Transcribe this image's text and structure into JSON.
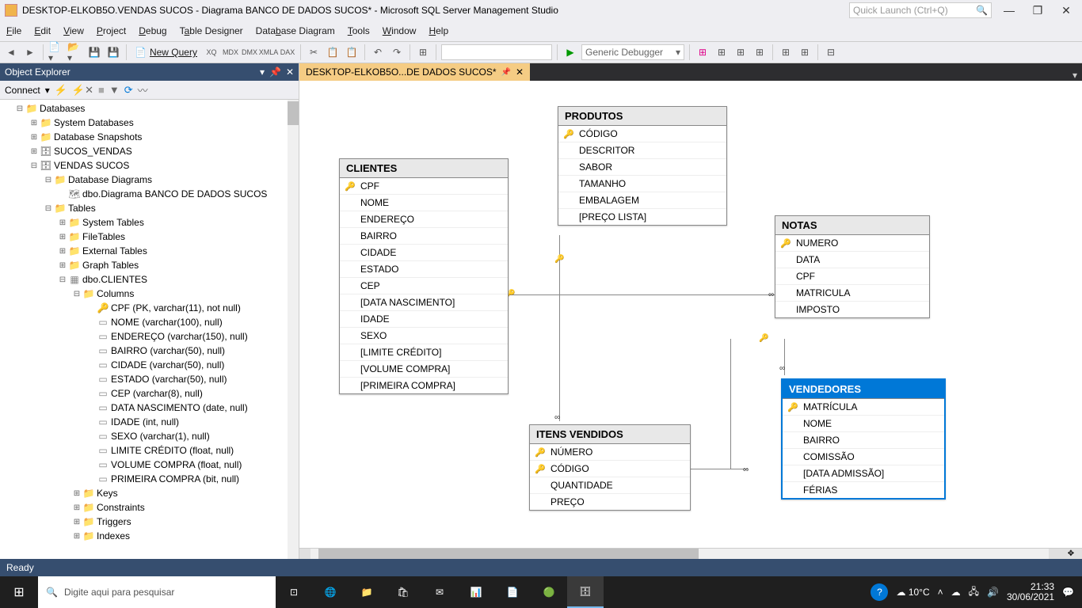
{
  "window": {
    "title": "DESKTOP-ELKOB5O.VENDAS SUCOS - Diagrama BANCO DE DADOS SUCOS* - Microsoft SQL Server Management Studio",
    "quick_launch": "Quick Launch (Ctrl+Q)"
  },
  "menubar": [
    "File",
    "Edit",
    "View",
    "Project",
    "Debug",
    "Table Designer",
    "Database Diagram",
    "Tools",
    "Window",
    "Help"
  ],
  "toolbar": {
    "new_query": "New Query",
    "debugger": "Generic Debugger"
  },
  "objexp": {
    "title": "Object Explorer",
    "connect": "Connect",
    "tree": [
      {
        "d": 1,
        "tw": "-",
        "ic": "folder",
        "tx": "Databases"
      },
      {
        "d": 2,
        "tw": "+",
        "ic": "folder",
        "tx": "System Databases"
      },
      {
        "d": 2,
        "tw": "+",
        "ic": "folder",
        "tx": "Database Snapshots"
      },
      {
        "d": 2,
        "tw": "+",
        "ic": "db",
        "tx": "SUCOS_VENDAS"
      },
      {
        "d": 2,
        "tw": "-",
        "ic": "db",
        "tx": "VENDAS SUCOS"
      },
      {
        "d": 3,
        "tw": "-",
        "ic": "folder",
        "tx": "Database Diagrams"
      },
      {
        "d": 4,
        "tw": "",
        "ic": "diag",
        "tx": "dbo.Diagrama BANCO DE DADOS SUCOS"
      },
      {
        "d": 3,
        "tw": "-",
        "ic": "folder",
        "tx": "Tables"
      },
      {
        "d": 4,
        "tw": "+",
        "ic": "folder",
        "tx": "System Tables"
      },
      {
        "d": 4,
        "tw": "+",
        "ic": "folder",
        "tx": "FileTables"
      },
      {
        "d": 4,
        "tw": "+",
        "ic": "folder",
        "tx": "External Tables"
      },
      {
        "d": 4,
        "tw": "+",
        "ic": "folder",
        "tx": "Graph Tables"
      },
      {
        "d": 4,
        "tw": "-",
        "ic": "table",
        "tx": "dbo.CLIENTES"
      },
      {
        "d": 5,
        "tw": "-",
        "ic": "folder",
        "tx": "Columns"
      },
      {
        "d": 6,
        "tw": "",
        "ic": "key",
        "tx": "CPF (PK, varchar(11), not null)"
      },
      {
        "d": 6,
        "tw": "",
        "ic": "col",
        "tx": "NOME (varchar(100), null)"
      },
      {
        "d": 6,
        "tw": "",
        "ic": "col",
        "tx": "ENDEREÇO (varchar(150), null)"
      },
      {
        "d": 6,
        "tw": "",
        "ic": "col",
        "tx": "BAIRRO (varchar(50), null)"
      },
      {
        "d": 6,
        "tw": "",
        "ic": "col",
        "tx": "CIDADE (varchar(50), null)"
      },
      {
        "d": 6,
        "tw": "",
        "ic": "col",
        "tx": "ESTADO (varchar(50), null)"
      },
      {
        "d": 6,
        "tw": "",
        "ic": "col",
        "tx": "CEP (varchar(8), null)"
      },
      {
        "d": 6,
        "tw": "",
        "ic": "col",
        "tx": "DATA NASCIMENTO (date, null)"
      },
      {
        "d": 6,
        "tw": "",
        "ic": "col",
        "tx": "IDADE (int, null)"
      },
      {
        "d": 6,
        "tw": "",
        "ic": "col",
        "tx": "SEXO (varchar(1), null)"
      },
      {
        "d": 6,
        "tw": "",
        "ic": "col",
        "tx": "LIMITE CRÉDITO (float, null)"
      },
      {
        "d": 6,
        "tw": "",
        "ic": "col",
        "tx": "VOLUME COMPRA (float, null)"
      },
      {
        "d": 6,
        "tw": "",
        "ic": "col",
        "tx": "PRIMEIRA COMPRA (bit, null)"
      },
      {
        "d": 5,
        "tw": "+",
        "ic": "folder",
        "tx": "Keys"
      },
      {
        "d": 5,
        "tw": "+",
        "ic": "folder",
        "tx": "Constraints"
      },
      {
        "d": 5,
        "tw": "+",
        "ic": "folder",
        "tx": "Triggers"
      },
      {
        "d": 5,
        "tw": "+",
        "ic": "folder",
        "tx": "Indexes"
      }
    ]
  },
  "tab": {
    "label": "DESKTOP-ELKOB5O...DE DADOS SUCOS*"
  },
  "diagram": {
    "tables": {
      "clientes": {
        "name": "CLIENTES",
        "cols": [
          {
            "k": true,
            "n": "CPF"
          },
          {
            "k": false,
            "n": "NOME"
          },
          {
            "k": false,
            "n": "ENDEREÇO"
          },
          {
            "k": false,
            "n": "BAIRRO"
          },
          {
            "k": false,
            "n": "CIDADE"
          },
          {
            "k": false,
            "n": "ESTADO"
          },
          {
            "k": false,
            "n": "CEP"
          },
          {
            "k": false,
            "n": "[DATA NASCIMENTO]"
          },
          {
            "k": false,
            "n": "IDADE"
          },
          {
            "k": false,
            "n": "SEXO"
          },
          {
            "k": false,
            "n": "[LIMITE CRÉDITO]"
          },
          {
            "k": false,
            "n": "[VOLUME COMPRA]"
          },
          {
            "k": false,
            "n": "[PRIMEIRA COMPRA]"
          }
        ]
      },
      "produtos": {
        "name": "PRODUTOS",
        "cols": [
          {
            "k": true,
            "n": "CÓDIGO"
          },
          {
            "k": false,
            "n": "DESCRITOR"
          },
          {
            "k": false,
            "n": "SABOR"
          },
          {
            "k": false,
            "n": "TAMANHO"
          },
          {
            "k": false,
            "n": "EMBALAGEM"
          },
          {
            "k": false,
            "n": "[PREÇO LISTA]"
          }
        ]
      },
      "notas": {
        "name": "NOTAS",
        "cols": [
          {
            "k": true,
            "n": "NUMERO"
          },
          {
            "k": false,
            "n": "DATA"
          },
          {
            "k": false,
            "n": "CPF"
          },
          {
            "k": false,
            "n": "MATRICULA"
          },
          {
            "k": false,
            "n": "IMPOSTO"
          }
        ]
      },
      "vendedores": {
        "name": "VENDEDORES",
        "selected": true,
        "cols": [
          {
            "k": true,
            "n": "MATRÍCULA"
          },
          {
            "k": false,
            "n": "NOME"
          },
          {
            "k": false,
            "n": "BAIRRO"
          },
          {
            "k": false,
            "n": "COMISSÃO"
          },
          {
            "k": false,
            "n": "[DATA ADMISSÃO]"
          },
          {
            "k": false,
            "n": "FÉRIAS"
          }
        ]
      },
      "itens": {
        "name": "ITENS VENDIDOS",
        "cols": [
          {
            "k": true,
            "n": "NÚMERO"
          },
          {
            "k": true,
            "n": "CÓDIGO"
          },
          {
            "k": false,
            "n": "QUANTIDADE"
          },
          {
            "k": false,
            "n": "PREÇO"
          }
        ]
      }
    }
  },
  "statusbar": {
    "text": "Ready"
  },
  "taskbar": {
    "search_placeholder": "Digite aqui para pesquisar",
    "weather": "10°C",
    "time": "21:33",
    "date": "30/06/2021"
  }
}
